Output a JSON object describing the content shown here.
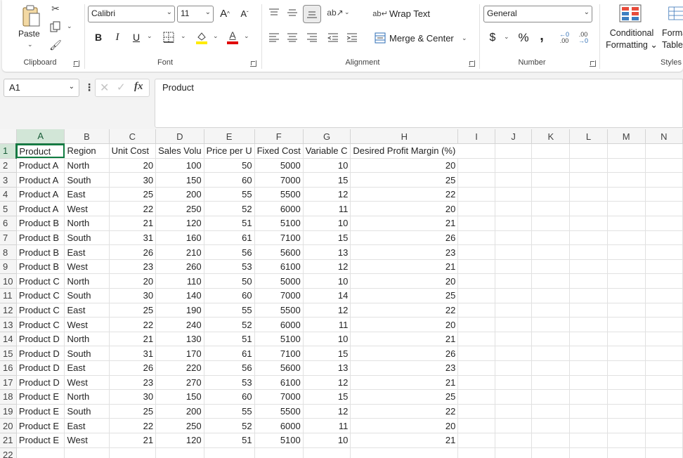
{
  "ribbon": {
    "clipboard": {
      "paste_label": "Paste",
      "group_label": "Clipboard"
    },
    "font": {
      "font_name": "Calibri",
      "font_size": "11",
      "bold": "B",
      "italic": "I",
      "underline": "U",
      "font_color_letter": "A",
      "grow": "A",
      "shrink": "A",
      "group_label": "Font"
    },
    "alignment": {
      "wrap_text": "Wrap Text",
      "merge_center": "Merge & Center",
      "group_label": "Alignment"
    },
    "number": {
      "format": "General",
      "currency": "$",
      "percent": "%",
      "comma": ",",
      "group_label": "Number"
    },
    "styles": {
      "conditional_line1": "Conditional",
      "conditional_line2": "Formatting",
      "format_table_line1": "Forma",
      "format_table_line2": "Table",
      "group_label": "Styles"
    }
  },
  "formula_bar": {
    "name_box": "A1",
    "fx": "fx",
    "content": "Product"
  },
  "columns": [
    "A",
    "B",
    "C",
    "D",
    "E",
    "F",
    "G",
    "H",
    "I",
    "J",
    "K",
    "L",
    "M",
    "N"
  ],
  "header_row": [
    "Product",
    "Region",
    "Unit Cost",
    "Sales Volu",
    "Price per U",
    "Fixed Cost",
    "Variable C",
    "Desired Profit Margin (%)"
  ],
  "rows": [
    [
      "Product A",
      "North",
      "20",
      "100",
      "50",
      "5000",
      "10",
      "20"
    ],
    [
      "Product A",
      "South",
      "30",
      "150",
      "60",
      "7000",
      "15",
      "25"
    ],
    [
      "Product A",
      "East",
      "25",
      "200",
      "55",
      "5500",
      "12",
      "22"
    ],
    [
      "Product A",
      "West",
      "22",
      "250",
      "52",
      "6000",
      "11",
      "20"
    ],
    [
      "Product B",
      "North",
      "21",
      "120",
      "51",
      "5100",
      "10",
      "21"
    ],
    [
      "Product B",
      "South",
      "31",
      "160",
      "61",
      "7100",
      "15",
      "26"
    ],
    [
      "Product B",
      "East",
      "26",
      "210",
      "56",
      "5600",
      "13",
      "23"
    ],
    [
      "Product B",
      "West",
      "23",
      "260",
      "53",
      "6100",
      "12",
      "21"
    ],
    [
      "Product C",
      "North",
      "20",
      "110",
      "50",
      "5000",
      "10",
      "20"
    ],
    [
      "Product C",
      "South",
      "30",
      "140",
      "60",
      "7000",
      "14",
      "25"
    ],
    [
      "Product C",
      "East",
      "25",
      "190",
      "55",
      "5500",
      "12",
      "22"
    ],
    [
      "Product C",
      "West",
      "22",
      "240",
      "52",
      "6000",
      "11",
      "20"
    ],
    [
      "Product D",
      "North",
      "21",
      "130",
      "51",
      "5100",
      "10",
      "21"
    ],
    [
      "Product D",
      "South",
      "31",
      "170",
      "61",
      "7100",
      "15",
      "26"
    ],
    [
      "Product D",
      "East",
      "26",
      "220",
      "56",
      "5600",
      "13",
      "23"
    ],
    [
      "Product D",
      "West",
      "23",
      "270",
      "53",
      "6100",
      "12",
      "21"
    ],
    [
      "Product E",
      "North",
      "30",
      "150",
      "60",
      "7000",
      "15",
      "25"
    ],
    [
      "Product E",
      "South",
      "25",
      "200",
      "55",
      "5500",
      "12",
      "22"
    ],
    [
      "Product E",
      "East",
      "22",
      "250",
      "52",
      "6000",
      "11",
      "20"
    ],
    [
      "Product E",
      "West",
      "21",
      "120",
      "51",
      "5100",
      "10",
      "21"
    ]
  ],
  "colors": {
    "accent": "#107c41",
    "header_bg": "#f5f5f5",
    "selected_header": "#d2e6d7"
  }
}
